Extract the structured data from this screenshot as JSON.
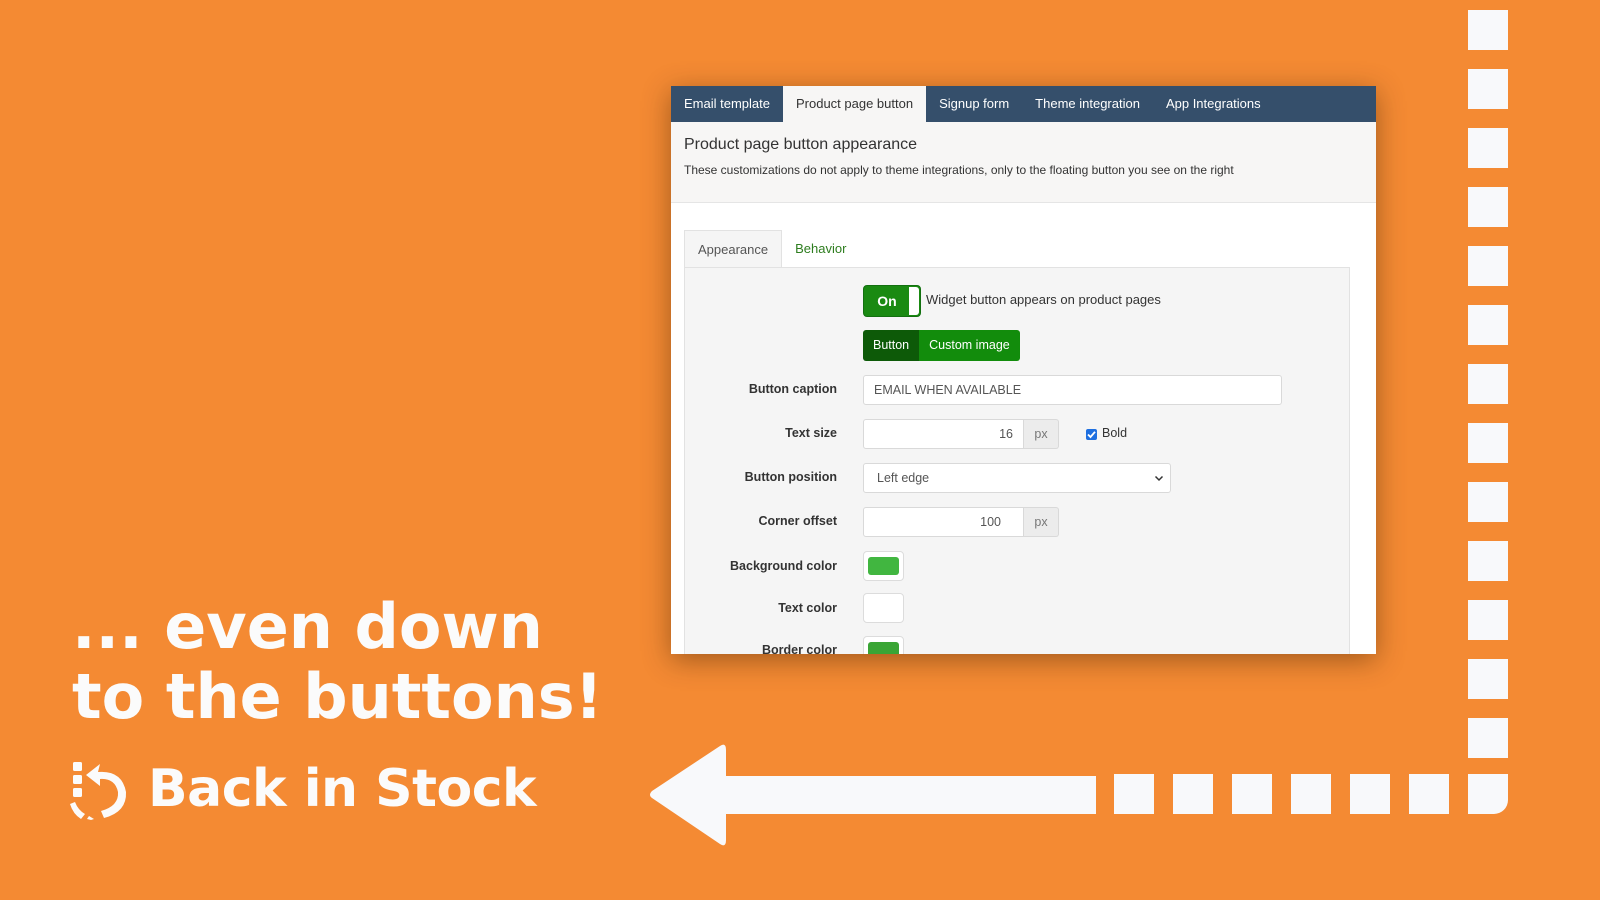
{
  "app": {
    "top_tabs": [
      {
        "label": "Email template",
        "active": false
      },
      {
        "label": "Product page button",
        "active": true
      },
      {
        "label": "Signup form",
        "active": false
      },
      {
        "label": "Theme integration",
        "active": false
      },
      {
        "label": "App Integrations",
        "active": false
      }
    ],
    "header": {
      "title": "Product page button appearance",
      "description": "These customizations do not apply to theme integrations, only to the floating button you see on the right"
    },
    "sub_tabs": [
      {
        "label": "Appearance",
        "active": true
      },
      {
        "label": "Behavior",
        "active": false
      }
    ],
    "form": {
      "widget_toggle": {
        "label": "On",
        "state": "on",
        "description": "Widget button appears on product pages"
      },
      "button_type": {
        "options": [
          "Button",
          "Custom image"
        ],
        "selected": "Button"
      },
      "button_caption": {
        "label": "Button caption",
        "value": "EMAIL WHEN AVAILABLE"
      },
      "text_size": {
        "label": "Text size",
        "value": "16",
        "unit": "px",
        "bold_label": "Bold",
        "bold_checked": true
      },
      "button_position": {
        "label": "Button position",
        "value": "Left edge"
      },
      "corner_offset": {
        "label": "Corner offset",
        "value": "100",
        "unit": "px"
      },
      "background_color": {
        "label": "Background color",
        "value": "#41b640"
      },
      "text_color": {
        "label": "Text color",
        "value": "#ffffff"
      },
      "border_color": {
        "label": "Border color",
        "value": "#3aa535"
      }
    }
  },
  "promo": {
    "headline_line1": "... even down",
    "headline_line2": "to the buttons!",
    "brand_name": "Back in Stock",
    "brand_icon": "refresh-arrow-icon",
    "background_color": "#f48a33"
  }
}
